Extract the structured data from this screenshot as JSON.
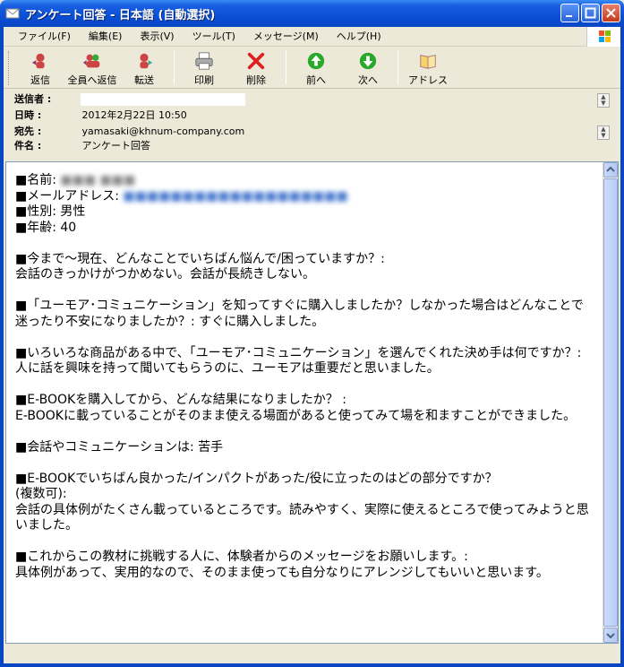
{
  "window": {
    "title": "アンケート回答 - 日本語 (自動選択)"
  },
  "menu": {
    "items": [
      "ファイル(F)",
      "編集(E)",
      "表示(V)",
      "ツール(T)",
      "メッセージ(M)",
      "ヘルプ(H)"
    ]
  },
  "toolbar": {
    "reply": "返信",
    "reply_all": "全員へ返信",
    "forward": "転送",
    "print": "印刷",
    "delete": "削除",
    "prev": "前へ",
    "next": "次へ",
    "address": "アドレス"
  },
  "header": {
    "from_label": "送信者 :",
    "date_label": "日時 :",
    "date_value": "2012年2月22日 10:50",
    "to_label": "宛先 :",
    "to_value": "yamasaki@khnum-company.com",
    "subject_label": "件名 :",
    "subject_value": "アンケート回答"
  },
  "body": {
    "name_label": "■名前:",
    "name_value": "■■■ ■■■",
    "email_label": "■メールアドレス:",
    "email_value": "■■■■■■■■■■■■■■■■■■■",
    "gender": "■性別: 男性",
    "age": "■年齢: 40",
    "q1": "■今まで～現在、どんなことでいちばん悩んで/困っていますか？:",
    "a1": "会話のきっかけがつかめない。会話が長続きしない。",
    "q2": "■「ユーモア･コミュニケーション」を知ってすぐに購入しましたか？しなかった場合はどんなことで",
    "q2b": "迷ったり不安になりましたか？: すぐに購入しました。",
    "q3": "■いろいろな商品がある中で、「ユーモア･コミュニケーション」を選んでくれた決め手は何ですか？: 人に話を興味を持って聞いてもらうのに、ユーモアは重要だと思いました。",
    "q4": "■E-BOOKを購入してから、どんな結果になりましたか？ :",
    "a4": "E-BOOKに載っていることがそのまま使える場面があると使ってみて場を和ますことができました。",
    "q5": "■会話やコミュニケーションは: 苦手",
    "q6": "■E-BOOKでいちばん良かった/インパクトがあった/役に立ったのはどの部分ですか？",
    "q6b": "(複数可):",
    "a6": "会話の具体例がたくさん載っているところです。読みやすく、実際に使えるところで使ってみようと思いました。",
    "q7": "■これからこの教材に挑戦する人に、体験者からのメッセージをお願いします。:",
    "a7": "具体例があって、実用的なので、そのまま使っても自分なりにアレンジしてもいいと思います。"
  }
}
